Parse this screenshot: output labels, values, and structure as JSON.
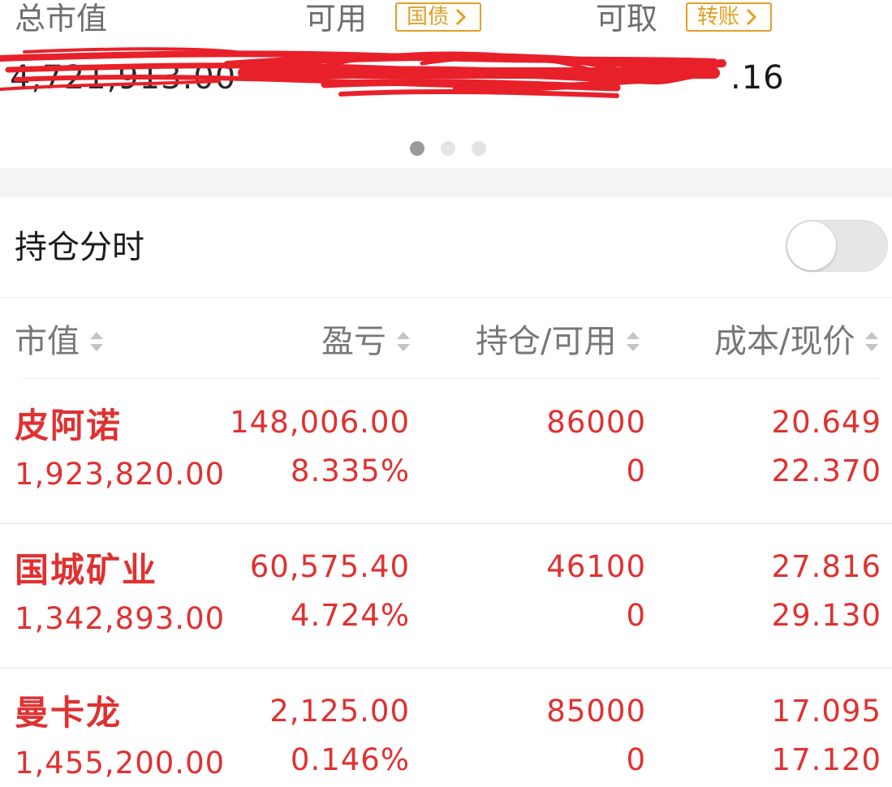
{
  "account": {
    "total_value_label": "总市值",
    "total_value": "4,721,913.00",
    "available_label": "可用",
    "available_badge": "国债",
    "available_value": "",
    "withdrawable_label": "可取",
    "withdrawable_badge": "转账",
    "withdrawable_value": ".16",
    "badge_icon": "chevron-right-icon"
  },
  "pager": {
    "count": 3,
    "active": 0
  },
  "position_intraday": {
    "label": "持仓分时",
    "enabled": false
  },
  "table": {
    "columns": [
      {
        "label": "市值"
      },
      {
        "label": "盈亏"
      },
      {
        "label": "持仓/可用"
      },
      {
        "label": "成本/现价"
      }
    ],
    "rows": [
      {
        "name": "皮阿诺",
        "market_value": "1,923,820.00",
        "pnl": "148,006.00",
        "pnl_pct": "8.335%",
        "holding": "86000",
        "available": "0",
        "cost": "20.649",
        "price": "22.370"
      },
      {
        "name": "国城矿业",
        "market_value": "1,342,893.00",
        "pnl": "60,575.40",
        "pnl_pct": "4.724%",
        "holding": "46100",
        "available": "0",
        "cost": "27.816",
        "price": "29.130"
      },
      {
        "name": "曼卡龙",
        "market_value": "1,455,200.00",
        "pnl": "2,125.00",
        "pnl_pct": "0.146%",
        "holding": "85000",
        "available": "0",
        "cost": "17.095",
        "price": "17.120"
      }
    ]
  },
  "colors": {
    "profit": "#e03131",
    "badge": "#e0a02c",
    "muted_text": "#6e6e6e",
    "scribble": "#e8202a"
  }
}
